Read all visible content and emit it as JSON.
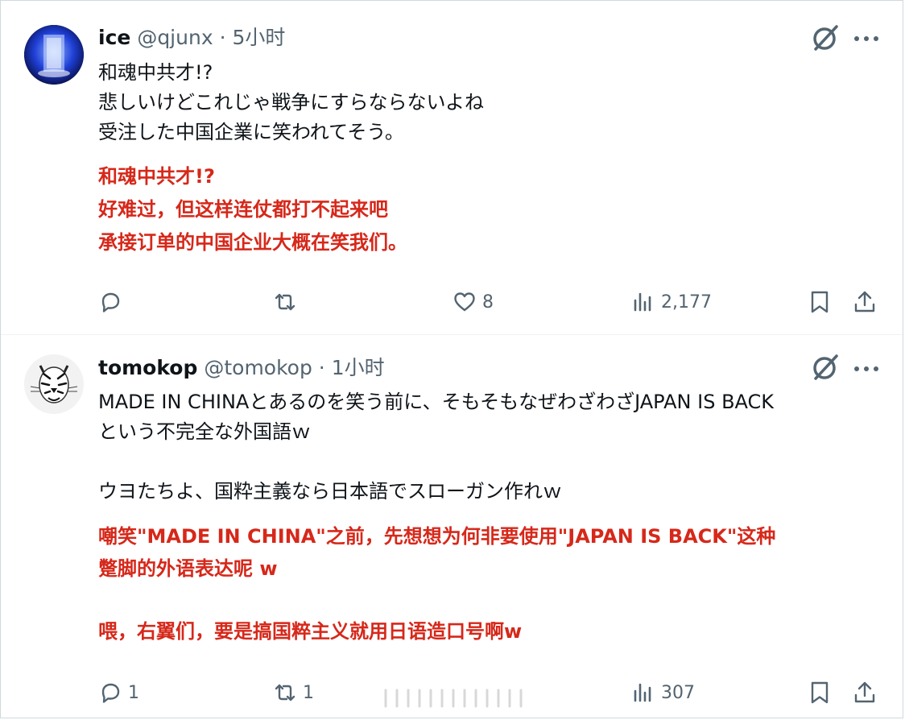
{
  "posts": [
    {
      "author": {
        "name": "ice",
        "handle": "@qjunx"
      },
      "separator": " · ",
      "time": "5小时",
      "original_lines": [
        "和魂中共才!?",
        "悲しいけどこれじゃ戦争にすらならないよね",
        "受注した中国企業に笑われてそう。"
      ],
      "translation_lines": [
        "和魂中共才!?",
        "好难过，但这样连仗都打不起来吧",
        "承接订单的中国企业大概在笑我们。"
      ],
      "stats": {
        "replies": "",
        "retweets": "",
        "likes": "8",
        "views": "2,177"
      }
    },
    {
      "author": {
        "name": "tomokop",
        "handle": "@tomokop"
      },
      "separator": " · ",
      "time": "1小时",
      "original_lines": [
        "MADE IN CHINAとあるのを笑う前に、そもそもなぜわざわざJAPAN IS BACK",
        "という不完全な外国語ｗ",
        "",
        "ウヨたちよ、国粋主義なら日本語でスローガン作れｗ"
      ],
      "translation_lines": [
        "嘲笑\"MADE IN CHINA\"之前，先想想为何非要使用\"JAPAN IS BACK\"这种",
        "蹩脚的外语表达呢 w",
        "",
        "喂，右翼们，要是搞国粹主义就用日语造口号啊w"
      ],
      "stats": {
        "replies": "1",
        "retweets": "1",
        "likes": "",
        "views": "307"
      }
    }
  ],
  "icons": {
    "reply": "reply-icon",
    "retweet": "retweet-icon",
    "like": "heart-icon",
    "views": "views-icon",
    "bookmark": "bookmark-icon",
    "share": "share-icon",
    "grok": "grok-icon",
    "more": "more-icon"
  },
  "colors": {
    "text": "#0f1419",
    "secondary": "#536471",
    "translation": "#d6281a",
    "border": "#eff3f4"
  }
}
